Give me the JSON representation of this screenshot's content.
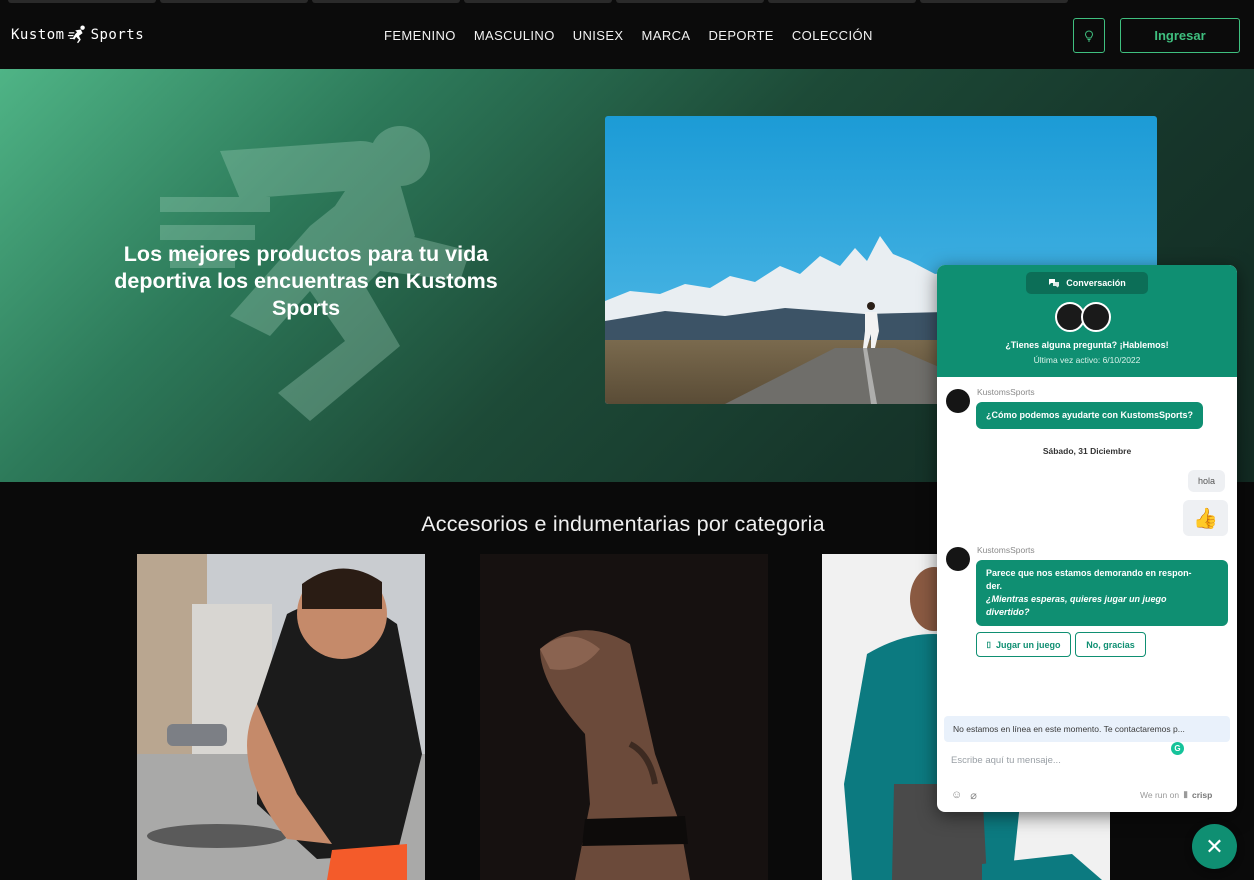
{
  "brand": {
    "logo_left": "Kustom",
    "logo_right": "Sports",
    "logo_icon": "running-figure-icon"
  },
  "nav": {
    "items": [
      "FEMENINO",
      "MASCULINO",
      "UNISEX",
      "MARCA",
      "DEPORTE",
      "COLECCIÓN"
    ]
  },
  "header_actions": {
    "bulb_icon": "lightbulb-icon",
    "login_label": "Ingresar"
  },
  "colors": {
    "accent": "#3fbf7f",
    "chat_primary": "#0f8f72",
    "page_bg": "#0a0a0a"
  },
  "hero": {
    "title": "Los mejores productos para tu vida deportiva los encuentras en Kustoms Sports"
  },
  "categories": {
    "title": "Accesorios e indumentarias por categoria"
  },
  "chat": {
    "header_pill": "Conversación",
    "headline": "¿Tienes alguna pregunta? ¡Hablemos!",
    "last_seen": "Última vez activo: 6/10/2022",
    "operator_name": "KustomsSports",
    "welcome": "¿Cómo podemos ayudarte con KustomsSports?",
    "date_separator": "Sábado, 31 Diciembre",
    "user_message": "hola",
    "user_emoji": "👍",
    "delay_line1": "Parece que nos estamos demorando en respon-",
    "delay_line2": "der.",
    "delay_italic1": "¿Mientras esperas, quieres jugar un juego",
    "delay_italic2": "divertido?",
    "chip_play": "Jugar un juego",
    "chip_no": "No, gracias",
    "offline_note": "No estamos en línea en este momento. Te contactaremos p...",
    "input_placeholder": "Escribe aquí tu mensaje...",
    "powered_prefix": "We run on",
    "powered_brand": "crisp"
  }
}
